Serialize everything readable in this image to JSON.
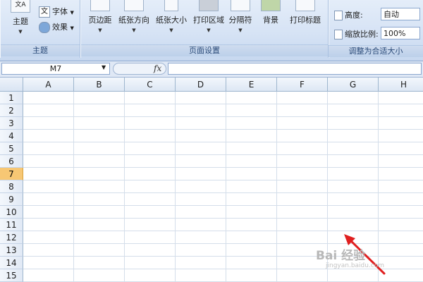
{
  "ribbon": {
    "themes_group": {
      "title": "主题",
      "themes_label": "主题",
      "fonts_label": "字体",
      "effects_label": "效果",
      "fonts_glyph": "文"
    },
    "page_setup_group": {
      "title": "页面设置",
      "margins_label": "页边距",
      "orientation_label": "纸张方向",
      "size_label": "纸张大小",
      "print_area_label": "打印区域",
      "breaks_label": "分隔符",
      "background_label": "背景",
      "print_titles_label": "打印标题"
    },
    "scale_group": {
      "title": "调整为合适大小",
      "height_label": "高度:",
      "height_value": "自动",
      "scale_label": "缩放比例:",
      "scale_value": "100%"
    }
  },
  "formula_bar": {
    "name_box": "M7",
    "fx_label": "fx",
    "formula": ""
  },
  "grid": {
    "columns": [
      "A",
      "B",
      "C",
      "D",
      "E",
      "F",
      "G",
      "H"
    ],
    "rows": [
      "1",
      "2",
      "3",
      "4",
      "5",
      "6",
      "7",
      "8",
      "9",
      "10",
      "11",
      "12",
      "13",
      "14",
      "15"
    ],
    "active_row": "7"
  },
  "annotation": {
    "arrow_color": "#e02020"
  },
  "watermark": {
    "text": "Bai 经验",
    "subtext": "jingyan.baidu.com"
  },
  "icons": [
    "themes-icon",
    "fonts-icon",
    "effects-icon",
    "margins-icon",
    "orientation-icon",
    "size-icon",
    "print-area-icon",
    "breaks-icon",
    "background-icon",
    "print-titles-icon",
    "height-icon",
    "scale-icon",
    "fx-icon",
    "dropdown-arrow-icon",
    "dialog-launcher-icon"
  ]
}
